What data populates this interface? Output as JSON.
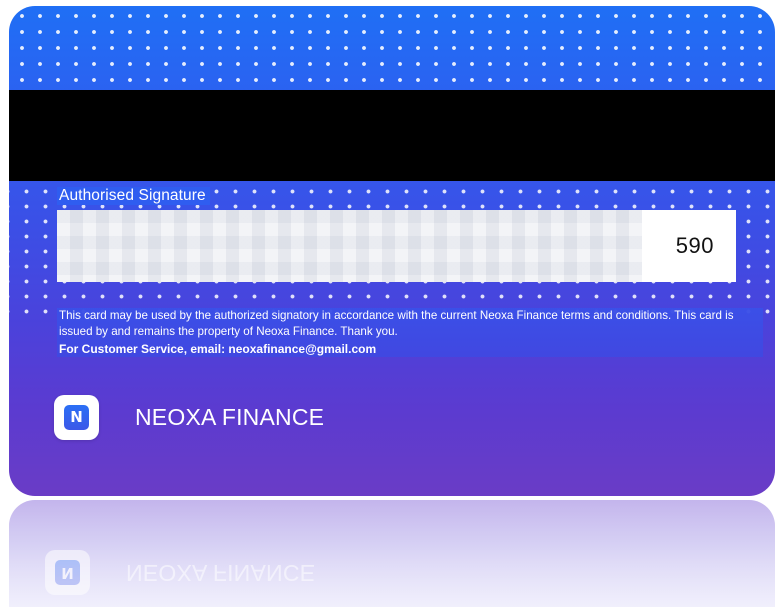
{
  "card": {
    "signature_label": "Authorised Signature",
    "cvv": "590",
    "terms_text": "This card may be used by the authorized signatory in accordance with the current Neoxa Finance terms and conditions. This card is issued by and remains the property of Neoxa Finance. Thank you.",
    "customer_service": "For Customer Service, email: neoxafinance@gmail.com",
    "brand": {
      "name": "NEOXA FINANCE",
      "logo_glyph": "N"
    }
  },
  "icons": {
    "logo": "neoxa-logo-icon"
  },
  "colors": {
    "card_top": "#1f6ff5",
    "card_bottom": "#6a3cc6",
    "stripe": "#000000",
    "signature_panel": "#f3f4f7",
    "text": "#ffffff"
  }
}
